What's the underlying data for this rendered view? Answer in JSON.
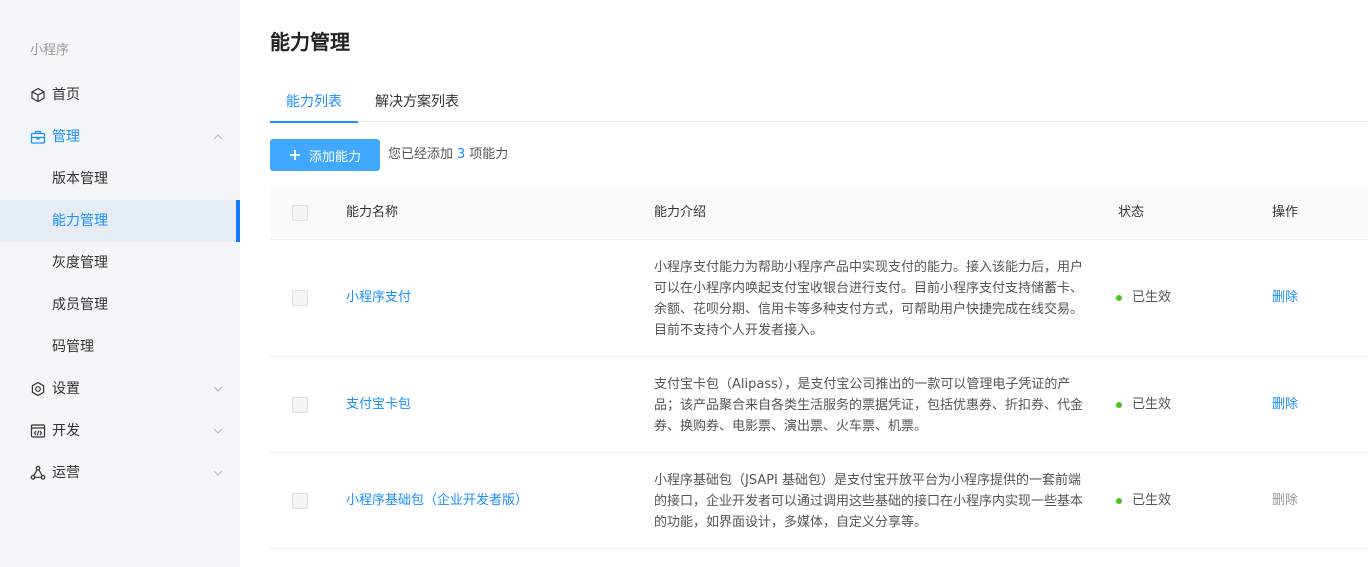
{
  "sidebar": {
    "section_title": "小程序",
    "items": [
      {
        "label": "首页",
        "icon": "cube-icon"
      },
      {
        "label": "管理",
        "icon": "briefcase-icon",
        "chevron": "up"
      },
      {
        "label": "设置",
        "icon": "gear-icon",
        "chevron": "down"
      },
      {
        "label": "开发",
        "icon": "code-window-icon",
        "chevron": "down"
      },
      {
        "label": "运营",
        "icon": "triangle-nodes-icon",
        "chevron": "down"
      }
    ],
    "sub_items": [
      {
        "label": "版本管理"
      },
      {
        "label": "能力管理",
        "selected": true
      },
      {
        "label": "灰度管理"
      },
      {
        "label": "成员管理"
      },
      {
        "label": "码管理"
      }
    ]
  },
  "main": {
    "title": "能力管理",
    "tabs": [
      {
        "label": "能力列表",
        "active": true
      },
      {
        "label": "解决方案列表"
      }
    ],
    "add_button_label": "添加能力",
    "summary": {
      "prefix": "您已经添加",
      "count": "3",
      "suffix": "项能力"
    },
    "table": {
      "headers": {
        "name": "能力名称",
        "description": "能力介绍",
        "status": "状态",
        "action": "操作"
      },
      "rows": [
        {
          "name": "小程序支付",
          "description": "小程序支付能力为帮助小程序产品中实现支付的能力。接入该能力后，用户可以在小程序内唤起支付宝收银台进行支付。目前小程序支付支持储蓄卡、余额、花呗分期、信用卡等多种支付方式，可帮助用户快捷完成在线交易。目前不支持个人开发者接入。",
          "status": "已生效",
          "action": "删除",
          "action_enabled": true
        },
        {
          "name": "支付宝卡包",
          "description": "支付宝卡包（Alipass），是支付宝公司推出的一款可以管理电子凭证的产品；该产品聚合来自各类生活服务的票据凭证，包括优惠券、折扣券、代金券、换购券、电影票、演出票、火车票、机票。",
          "status": "已生效",
          "action": "删除",
          "action_enabled": true
        },
        {
          "name": "小程序基础包（企业开发者版）",
          "description": "小程序基础包（JSAPI 基础包）是支付宝开放平台为小程序提供的一套前端的接口，企业开发者可以通过调用这些基础的接口在小程序内实现一些基本的功能，如界面设计，多媒体，自定义分享等。",
          "status": "已生效",
          "action": "删除",
          "action_enabled": false
        }
      ]
    }
  },
  "colors": {
    "accent": "#1890ff",
    "primary_button": "#40a9ff",
    "status_active": "#52c41a",
    "sidebar_bg": "#f5f6f7",
    "selected_bg": "#e6ecf3"
  }
}
